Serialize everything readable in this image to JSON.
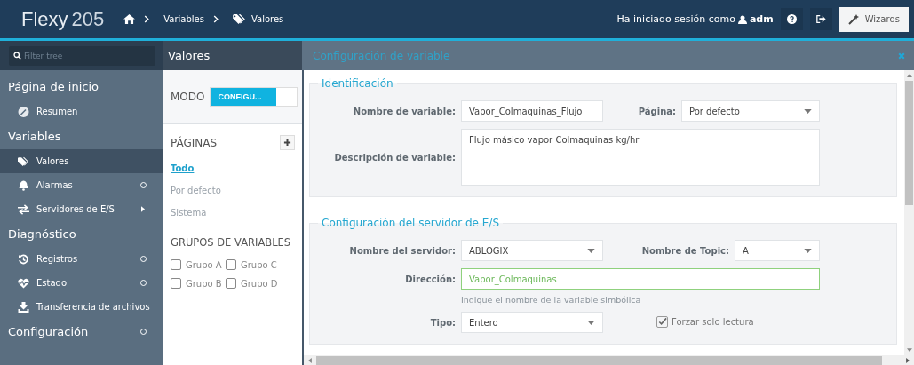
{
  "brand": {
    "name": "Flexy",
    "model": "205"
  },
  "breadcrumb": [
    "Variables",
    "Valores"
  ],
  "session": {
    "text": "Ha iniciado sesión como",
    "user": "adm"
  },
  "wizards": "Wizards",
  "filter": {
    "placeholder": "Filter tree"
  },
  "tree": [
    {
      "label": "Página de inicio",
      "collapsible": false,
      "children": [
        {
          "label": "Resumen",
          "selected": false,
          "collapsible": false,
          "submenu": false
        }
      ]
    },
    {
      "label": "Variables",
      "collapsible": false,
      "children": [
        {
          "label": "Valores",
          "selected": true,
          "collapsible": false,
          "submenu": false
        },
        {
          "label": "Alarmas",
          "selected": false,
          "collapsible": true,
          "submenu": false
        },
        {
          "label": "Servidores de E/S",
          "selected": false,
          "collapsible": false,
          "submenu": true
        }
      ]
    },
    {
      "label": "Diagnóstico",
      "collapsible": false,
      "children": [
        {
          "label": "Registros",
          "selected": false,
          "collapsible": true,
          "submenu": false
        },
        {
          "label": "Estado",
          "selected": false,
          "collapsible": true,
          "submenu": false
        },
        {
          "label": "Transferencia de archivos",
          "selected": false,
          "collapsible": false,
          "submenu": false
        }
      ]
    },
    {
      "label": "Configuración",
      "collapsible": true
    }
  ],
  "middle": {
    "title": "Valores",
    "mode": {
      "label": "MODO",
      "value": "CONFIGU...",
      "on": true
    },
    "pages": {
      "title": "PÁGINAS",
      "items": [
        {
          "label": "Todo",
          "selected": true
        },
        {
          "label": "Por defecto",
          "selected": false
        },
        {
          "label": "Sistema",
          "selected": false
        }
      ]
    },
    "groups": {
      "title": "GRUPOS DE VARIABLES",
      "items": [
        {
          "label": "Grupo A",
          "checked": false
        },
        {
          "label": "Grupo C",
          "checked": false
        },
        {
          "label": "Grupo B",
          "checked": false
        },
        {
          "label": "Grupo D",
          "checked": false
        }
      ]
    }
  },
  "config": {
    "title": "Configuración de variable",
    "sections": [
      {
        "title": "Identificación",
        "rows": [
          {
            "fields": [
              {
                "kind": "text",
                "label": "Nombre de variable:",
                "value": "Vapor_Colmaquinas_Flujo",
                "valid": false
              },
              {
                "kind": "select",
                "label": "Página:",
                "value": "Por defecto"
              }
            ]
          },
          {
            "fields": [
              {
                "kind": "textarea",
                "label": "Descripción de variable:",
                "value": "Flujo másico vapor Colmaquinas kg/hr"
              }
            ]
          }
        ]
      },
      {
        "title": "Configuración del servidor de E/S",
        "rows": [
          {
            "fields": [
              {
                "kind": "select",
                "label": "Nombre del servidor:",
                "value": "ABLOGIX"
              },
              {
                "kind": "select",
                "label": "Nombre de Topic:",
                "value": "A"
              }
            ]
          },
          {
            "fields": [
              {
                "kind": "text",
                "label": "Dirección:",
                "value": "Vapor_Colmaquinas",
                "valid": true,
                "hint": "Indique el nombre de la variable simbólica"
              }
            ]
          },
          {
            "fields": [
              {
                "kind": "select",
                "label": "Tipo:",
                "value": "Entero"
              },
              {
                "kind": "checkbox",
                "label": "Forzar solo lectura",
                "checked": true
              }
            ]
          }
        ]
      }
    ]
  }
}
